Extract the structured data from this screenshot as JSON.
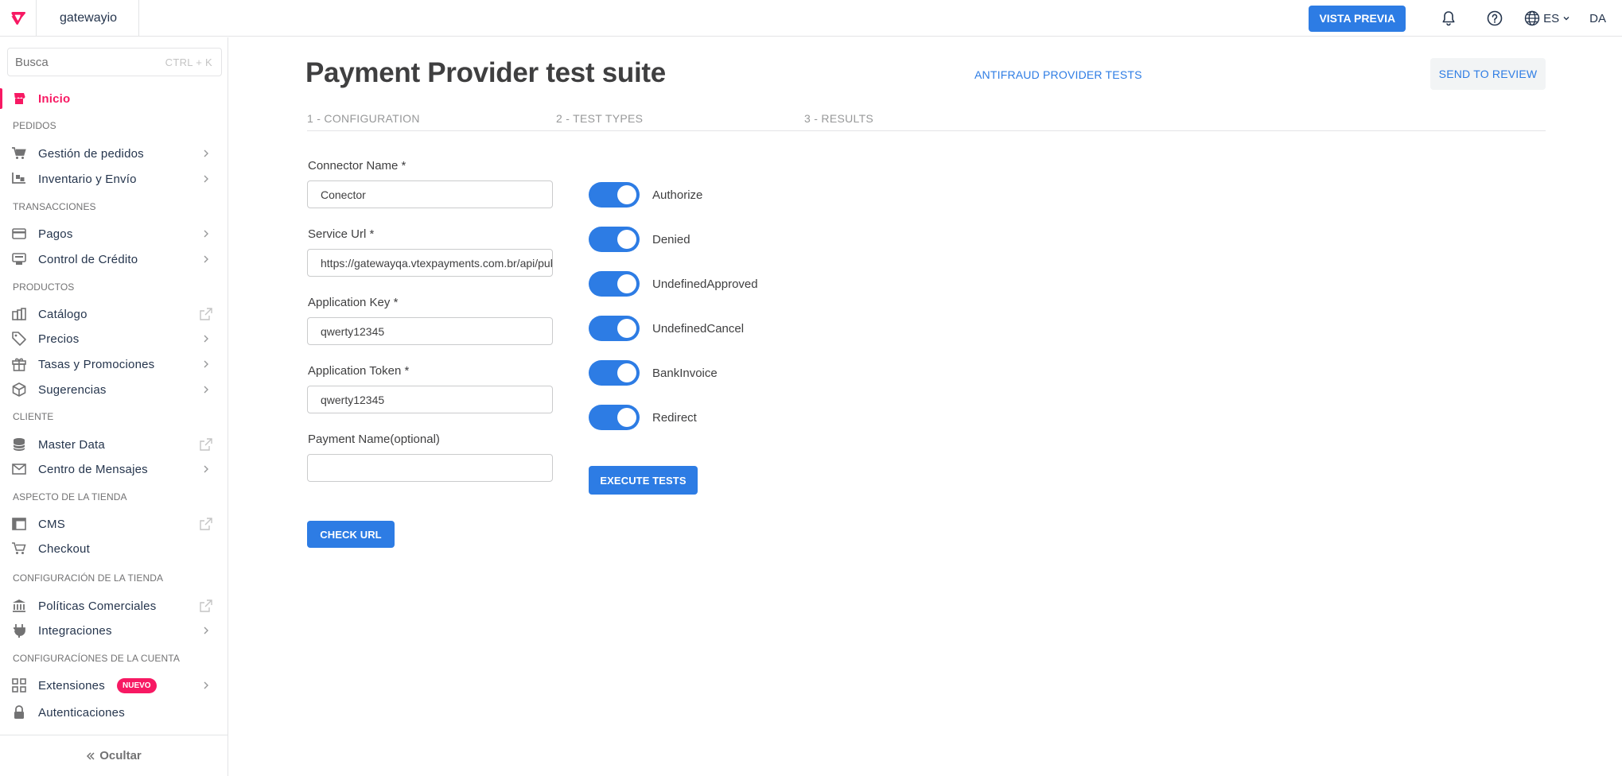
{
  "topbar": {
    "account": "gatewayio",
    "preview_label": "VISTA PREVIA",
    "language": "ES",
    "user_initials": "DA"
  },
  "sidebar": {
    "search_placeholder": "Busca",
    "search_shortcut": "CTRL + K",
    "home": "Inicio",
    "sections": {
      "pedidos": "PEDIDOS",
      "transacciones": "TRANSACCIONES",
      "productos": "PRODUCTOS",
      "cliente": "CLIENTE",
      "aspecto": "ASPECTO DE LA TIENDA",
      "config_tienda": "CONFIGURACIÓN DE LA TIENDA",
      "config_cuenta": "CONFIGURACÍONES DE LA CUENTA"
    },
    "items": {
      "gestion_pedidos": "Gestión de pedidos",
      "inventario": "Inventario y Envío",
      "pagos": "Pagos",
      "control_credito": "Control de Crédito",
      "catalogo": "Catálogo",
      "precios": "Precios",
      "tasas": "Tasas y Promociones",
      "sugerencias": "Sugerencias",
      "master_data": "Master Data",
      "centro_mensajes": "Centro de Mensajes",
      "cms": "CMS",
      "checkout": "Checkout",
      "politicas": "Políticas Comerciales",
      "integraciones": "Integraciones",
      "extensiones": "Extensiones",
      "autenticaciones": "Autenticaciones"
    },
    "badge_new": "NUEVO",
    "hide_label": "Ocultar"
  },
  "main": {
    "title": "Payment Provider test suite",
    "antifraud_link": "ANTIFRAUD PROVIDER TESTS",
    "send_review": "SEND TO REVIEW",
    "steps": [
      "1 - CONFIGURATION",
      "2 - TEST TYPES",
      "3 - RESULTS"
    ],
    "fields": {
      "connector_name": {
        "label": "Connector Name *",
        "value": "Conector"
      },
      "service_url": {
        "label": "Service Url *",
        "value": "https://gatewayqa.vtexpayments.com.br/api/pub/fake-payment-provider"
      },
      "app_key": {
        "label": "Application Key *",
        "value": "qwerty12345"
      },
      "app_token": {
        "label": "Application Token *",
        "value": "qwerty12345"
      },
      "payment_name": {
        "label": "Payment Name(optional)",
        "value": ""
      }
    },
    "check_url": "CHECK URL",
    "tests": [
      {
        "label": "Authorize",
        "enabled": true
      },
      {
        "label": "Denied",
        "enabled": true
      },
      {
        "label": "UndefinedApproved",
        "enabled": true
      },
      {
        "label": "UndefinedCancel",
        "enabled": true
      },
      {
        "label": "BankInvoice",
        "enabled": true
      },
      {
        "label": "Redirect",
        "enabled": true
      }
    ],
    "execute_tests": "EXECUTE TESTS"
  },
  "colors": {
    "brand_pink": "#f71963",
    "primary_blue": "#2d7ce4"
  }
}
